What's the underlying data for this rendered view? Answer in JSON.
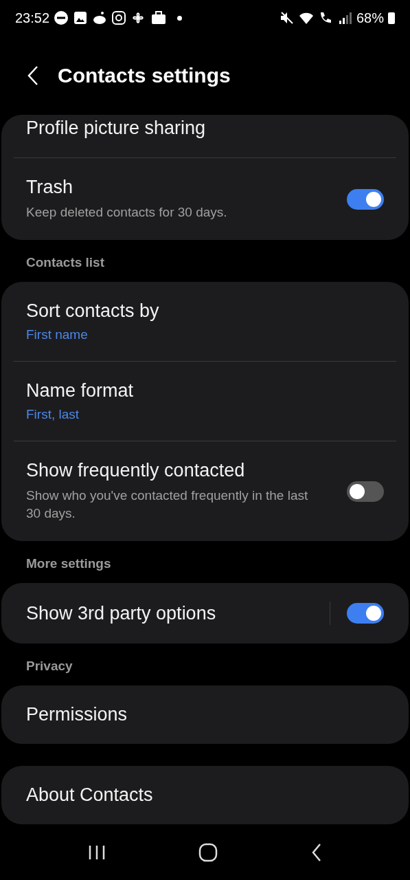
{
  "status_bar": {
    "time": "23:52",
    "battery": "68%"
  },
  "header": {
    "title": "Contacts settings"
  },
  "sections": [
    {
      "items": [
        {
          "kind": "link",
          "title": "Profile picture sharing",
          "clipped": true
        },
        {
          "kind": "switch",
          "title": "Trash",
          "description": "Keep deleted contacts for 30 days.",
          "on": true,
          "divider": false
        }
      ]
    },
    {
      "heading": "Contacts list",
      "items": [
        {
          "kind": "link",
          "title": "Sort contacts by",
          "value": "First name"
        },
        {
          "kind": "link",
          "title": "Name format",
          "value": "First, last"
        },
        {
          "kind": "switch",
          "title": "Show frequently contacted",
          "description": "Show who you've contacted frequently in the last 30 days.",
          "on": false,
          "divider": false
        }
      ]
    },
    {
      "heading": "More settings",
      "items": [
        {
          "kind": "switch",
          "title": "Show 3rd party options",
          "on": true,
          "divider": true
        }
      ]
    },
    {
      "heading": "Privacy",
      "items": [
        {
          "kind": "link",
          "title": "Permissions"
        }
      ]
    },
    {
      "items": [
        {
          "kind": "link",
          "title": "About Contacts"
        }
      ]
    }
  ]
}
